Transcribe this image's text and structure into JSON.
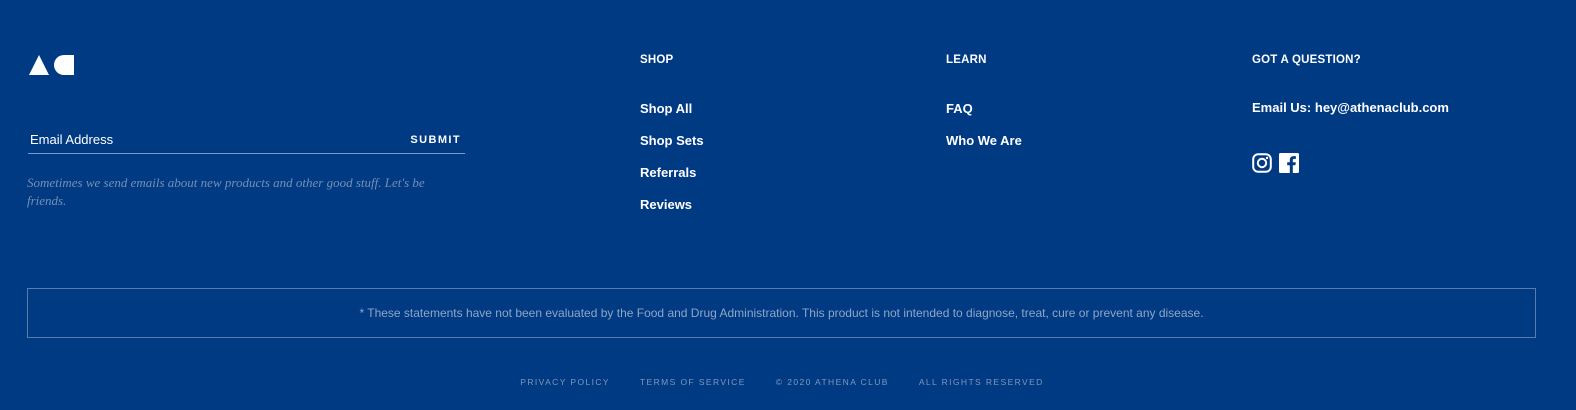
{
  "brand": {
    "logo_alt": "AC"
  },
  "newsletter": {
    "placeholder": "Email Address",
    "submit_label": "SUBMIT",
    "note": "Sometimes we send emails about new products and other good stuff. Let's be friends."
  },
  "shop": {
    "heading": "SHOP",
    "links": [
      "Shop All",
      "Shop Sets",
      "Referrals",
      "Reviews"
    ]
  },
  "learn": {
    "heading": "LEARN",
    "links": [
      "FAQ",
      "Who We Are"
    ]
  },
  "contact": {
    "heading": "GOT A QUESTION?",
    "email_label": "Email Us:",
    "email": "hey@athenaclub.com",
    "social": [
      "instagram-icon",
      "facebook-icon"
    ]
  },
  "disclaimer": "* These statements have not been evaluated by the Food and Drug Administration. This product is not intended to diagnose, treat, cure or prevent any disease.",
  "bottom": {
    "privacy": "PRIVACY POLICY",
    "terms": "TERMS OF SERVICE",
    "copyright": "© 2020 ATHENA CLUB",
    "rights": "ALL RIGHTS RESERVED"
  },
  "colors": {
    "background": "#003a82",
    "text": "#ffffff",
    "muted": "#7f97bd"
  }
}
